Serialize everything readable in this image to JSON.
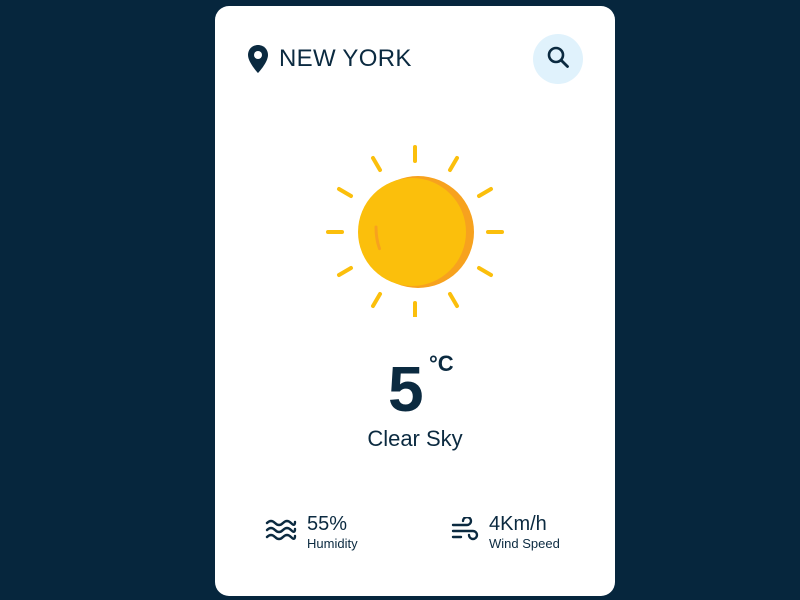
{
  "location": {
    "city": "NEW YORK",
    "icon": "location-pin-icon"
  },
  "search": {
    "icon": "search-icon"
  },
  "weather": {
    "icon": "sun-icon",
    "temperature": "5",
    "unit": "°C",
    "condition": "Clear Sky"
  },
  "stats": {
    "humidity": {
      "value": "55%",
      "label": "Humidity",
      "icon": "humidity-waves-icon"
    },
    "wind": {
      "value": "4Km/h",
      "label": "Wind Speed",
      "icon": "wind-icon"
    }
  },
  "colors": {
    "background": "#06263d",
    "card": "#ffffff",
    "text": "#0b2a40",
    "search_bg": "#e0f2fc",
    "sun": "#fbbf0c",
    "sun_shade": "#f7a21e"
  }
}
